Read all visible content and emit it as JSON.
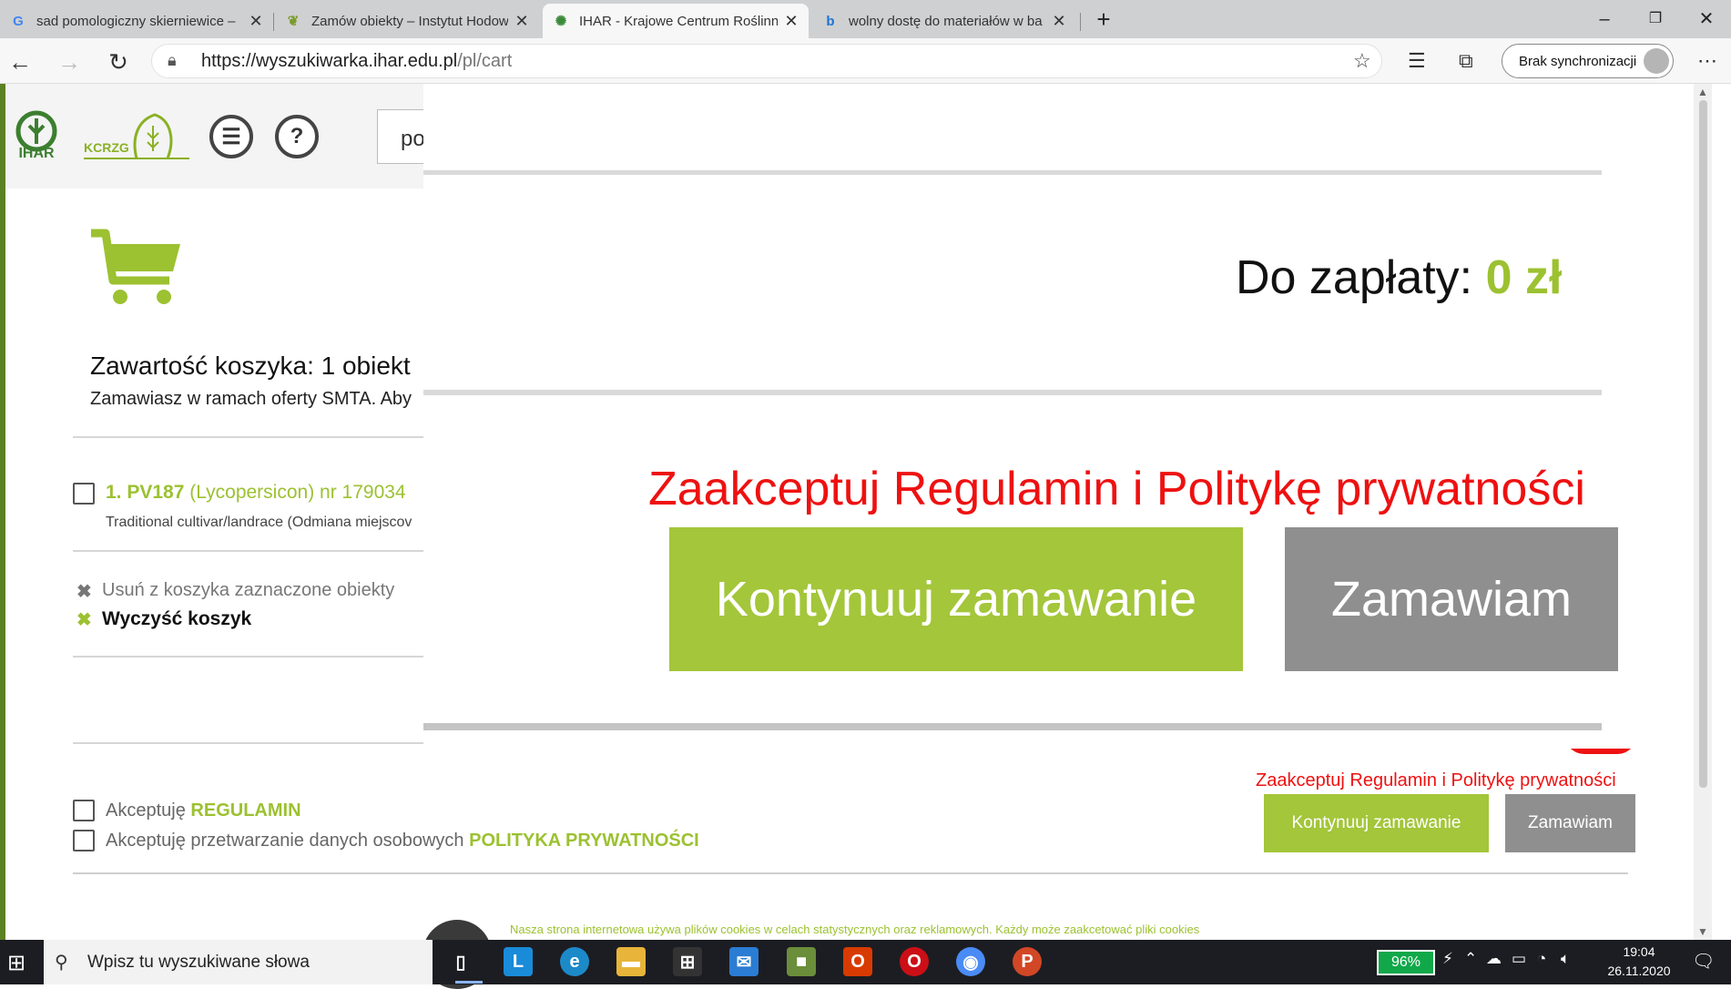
{
  "browser": {
    "tabs": [
      {
        "title": "sad pomologiczny skierniewice –",
        "favicon": "google-icon"
      },
      {
        "title": "Zamów obiekty – Instytut Hodow",
        "favicon": "leaf-icon"
      },
      {
        "title": "IHAR - Krajowe Centrum Roślinn",
        "favicon": "loading-icon",
        "active": true
      },
      {
        "title": "wolny dostę do materiałów w ba",
        "favicon": "bing-icon"
      }
    ],
    "url_host": "https://wyszukiwarka.ihar.edu.pl",
    "url_path": "/pl/cart",
    "sync_label": "Brak synchronizacji"
  },
  "site": {
    "logo1": "IHAR",
    "logo2": "KCRZG",
    "search_value": "po"
  },
  "cart": {
    "title": "Zawartość koszyka: 1 obiekt",
    "subtitle": "Zamawiasz w ramach oferty SMTA. Aby",
    "item_title": "1. PV187",
    "item_species": "(Lycopersicon) nr 179034",
    "item_desc": "Traditional cultivar/landrace (Odmiana miejscov",
    "remove_selected": "Usuń z koszyka zaznaczone obiekty",
    "clear_cart": "Wyczyść koszyk",
    "accept_terms_prefix": "Akceptuję",
    "accept_terms_link": "REGULAMIN",
    "accept_privacy_prefix": "Akceptuję przetwarzanie danych osobowych",
    "accept_privacy_link": "POLITYKA PRYWATNOŚCI",
    "require_msg": "Zaakceptuj Regulamin i Politykę prywatności",
    "continue_btn": "Kontynuuj zamawanie",
    "order_btn": "Zamawiam",
    "cookie_text": "Nasza strona internetowa używa plików cookies w celach statystycznych oraz reklamowych. Każdy może zaakcetować pliki cookies"
  },
  "overlay": {
    "total_label": "Do zapłaty:",
    "total_value": "0 zł",
    "require_msg": "Zaakceptuj Regulamin i Politykę prywatności",
    "continue_btn": "Kontynuuj zamawanie",
    "order_btn": "Zamawiam"
  },
  "taskbar": {
    "search_placeholder": "Wpisz tu wyszukiwane słowa",
    "battery": "96%",
    "time": "19:04",
    "date": "26.11.2020"
  },
  "colors": {
    "accent_green": "#9cc131",
    "button_green": "#a3c63a",
    "button_grey": "#8f8f8f",
    "warning_red": "#ee1111"
  }
}
